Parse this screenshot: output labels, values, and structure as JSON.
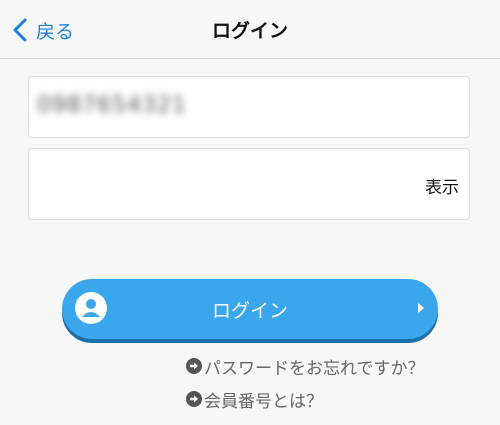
{
  "navbar": {
    "back_label": "戻る",
    "title": "ログイン"
  },
  "form": {
    "member_id_value": "0987654321",
    "password_value": "",
    "show_toggle_label": "表示"
  },
  "login_button": {
    "label": "ログイン",
    "icon": "user-avatar-icon",
    "trailing_icon": "triangle-right-icon"
  },
  "help_links": {
    "forgot_password": "パスワードをお忘れですか？",
    "member_number": "会員番号とは？",
    "icon": "arrow-right-circle-icon"
  },
  "colors": {
    "accent": "#1a7fe0",
    "button": "#3aa6eb",
    "button_shadow": "#1d6fa8",
    "background": "#f7f7f7",
    "link_text": "#666666"
  }
}
